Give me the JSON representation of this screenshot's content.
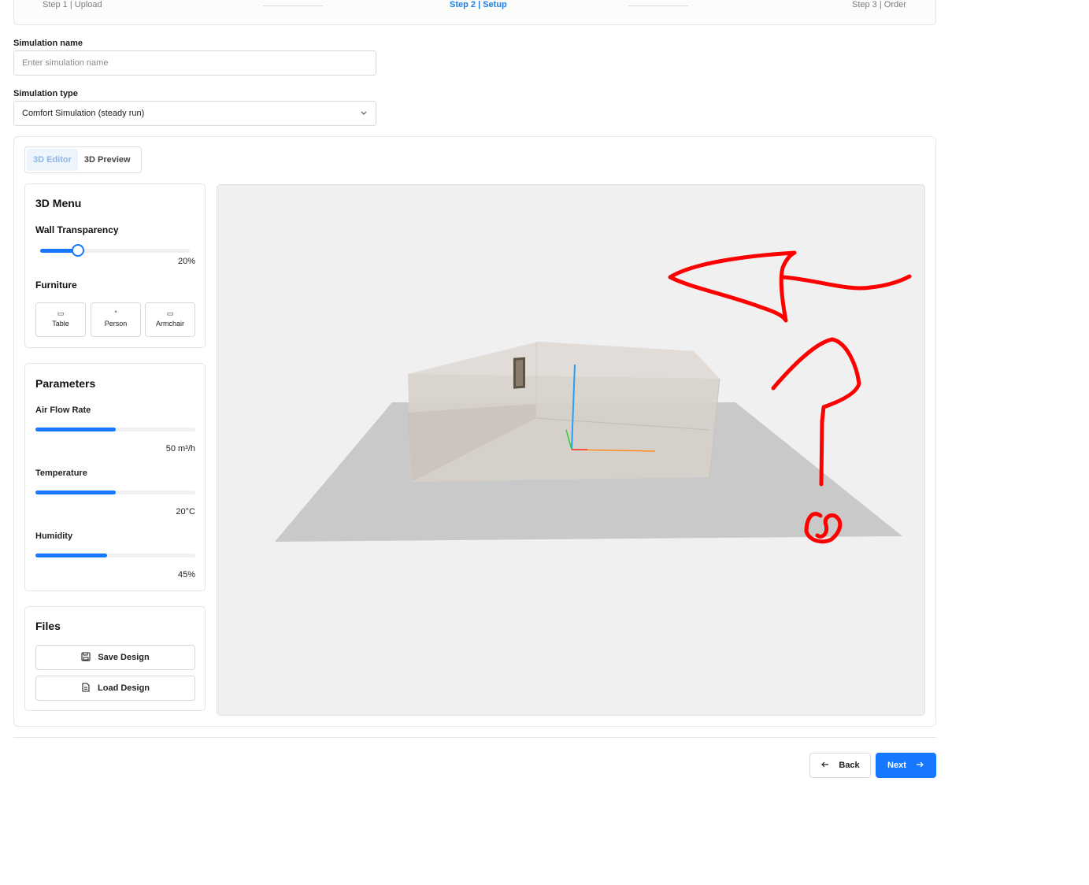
{
  "stepper": {
    "steps": [
      {
        "label": "Step 1 | Upload",
        "active": false
      },
      {
        "label": "Step 2 | Setup",
        "active": true
      },
      {
        "label": "Step 3 | Order",
        "active": false
      }
    ]
  },
  "form": {
    "name_label": "Simulation name",
    "name_placeholder": "Enter simulation name",
    "name_value": "",
    "type_label": "Simulation type",
    "type_value": "Comfort Simulation (steady run)",
    "type_icon": "chevron-down-icon"
  },
  "tabs": [
    {
      "label": "3D Editor",
      "active": true
    },
    {
      "label": "3D Preview",
      "active": false
    }
  ],
  "menu": {
    "title": "3D Menu",
    "wall_label": "Wall Transparency",
    "wall_value": "20%",
    "wall_fraction": 0.2,
    "furniture_label": "Furniture",
    "furniture": [
      {
        "label": "Table",
        "icon": "rectangle-icon"
      },
      {
        "label": "Person",
        "icon": "circle-icon"
      },
      {
        "label": "Armchair",
        "icon": "rectangle-icon"
      }
    ]
  },
  "parameters": {
    "title": "Parameters",
    "items": [
      {
        "label": "Air Flow Rate",
        "value": "50 m³/h",
        "fraction": 0.5
      },
      {
        "label": "Temperature",
        "value": "20°C",
        "fraction": 0.5
      },
      {
        "label": "Humidity",
        "value": "45%",
        "fraction": 0.45
      }
    ]
  },
  "files": {
    "title": "Files",
    "save_label": "Save Design",
    "save_icon": "save-icon",
    "load_label": "Load Design",
    "load_icon": "file-icon"
  },
  "viewport": {
    "annotation_color": "#ff0000",
    "axis_colors": {
      "x": "#ff8c1a",
      "y": "#2a9df4",
      "z": "#33cc33"
    }
  },
  "footer": {
    "back_label": "Back",
    "back_icon": "arrow-left-icon",
    "next_label": "Next",
    "next_icon": "arrow-right-icon",
    "accent": "#1677ff"
  }
}
